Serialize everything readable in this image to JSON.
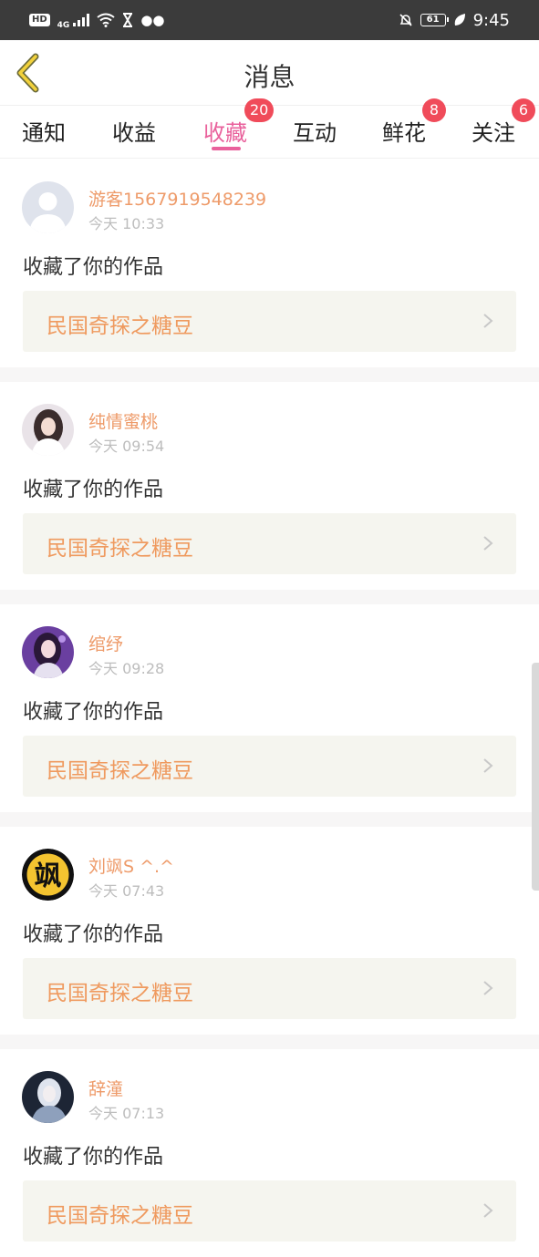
{
  "status_bar": {
    "hd": "HD",
    "network": "4G",
    "battery": "61",
    "time": "9:45"
  },
  "header": {
    "title": "消息"
  },
  "tabs": [
    {
      "label": "通知",
      "badge": null,
      "active": false
    },
    {
      "label": "收益",
      "badge": null,
      "active": false
    },
    {
      "label": "收藏",
      "badge": "20",
      "active": true
    },
    {
      "label": "互动",
      "badge": null,
      "active": false
    },
    {
      "label": "鲜花",
      "badge": "8",
      "active": false
    },
    {
      "label": "关注",
      "badge": "6",
      "active": false
    }
  ],
  "colors": {
    "accent": "#e9619c",
    "badge": "#f04b5a",
    "username": "#ee9b6a",
    "work_title": "#ef9a5f",
    "work_bg": "#f5f5ef"
  },
  "feed": [
    {
      "username": "游客1567919548239",
      "time": "今天 10:33",
      "action": "收藏了你的作品",
      "work": "民国奇探之糖豆",
      "avatar": "default-avatar"
    },
    {
      "username": "纯情蜜桃",
      "time": "今天 09:54",
      "action": "收藏了你的作品",
      "work": "民国奇探之糖豆",
      "avatar": "photo-avatar"
    },
    {
      "username": "绾纾",
      "time": "今天 09:28",
      "action": "收藏了你的作品",
      "work": "民国奇探之糖豆",
      "avatar": "photo-avatar"
    },
    {
      "username": "刘飒S ^.^",
      "time": "今天 07:43",
      "action": "收藏了你的作品",
      "work": "民国奇探之糖豆",
      "avatar": "character-avatar",
      "avatar_char": "飒"
    },
    {
      "username": "辞潼",
      "time": "今天 07:13",
      "action": "收藏了你的作品",
      "work": "民国奇探之糖豆",
      "avatar": "photo-avatar"
    }
  ]
}
